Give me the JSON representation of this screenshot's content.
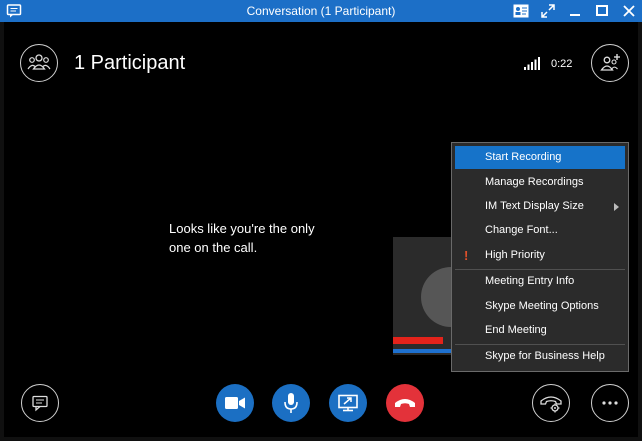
{
  "window": {
    "title": "Conversation (1 Participant)"
  },
  "header": {
    "participants_label": "1 Participant",
    "timer": "0:22"
  },
  "stage": {
    "message_line1": "Looks like you're the only",
    "message_line2": "one on the call."
  },
  "menu": {
    "items": [
      {
        "label": "Start Recording"
      },
      {
        "label": "Manage Recordings"
      },
      {
        "label": "IM Text Display Size"
      },
      {
        "label": "Change Font..."
      },
      {
        "label": "High Priority"
      },
      {
        "label": "Meeting Entry Info"
      },
      {
        "label": "Skype Meeting Options"
      },
      {
        "label": "End Meeting"
      },
      {
        "label": "Skype for Business Help"
      }
    ]
  },
  "colors": {
    "titlebar": "#1c6fc7",
    "control_blue": "#1b6fc3",
    "end_call_red": "#e3323a",
    "menu_highlight": "#1673c9"
  },
  "icons": {
    "app": "chat-bubble-icon",
    "participants": "people-icon",
    "add_participant": "add-people-icon",
    "im": "chat-icon",
    "video": "video-camera-icon",
    "mic": "microphone-icon",
    "present": "present-screen-icon",
    "hangup": "hang-up-icon",
    "call_controls": "phone-gear-icon",
    "more": "more-options-icon"
  }
}
